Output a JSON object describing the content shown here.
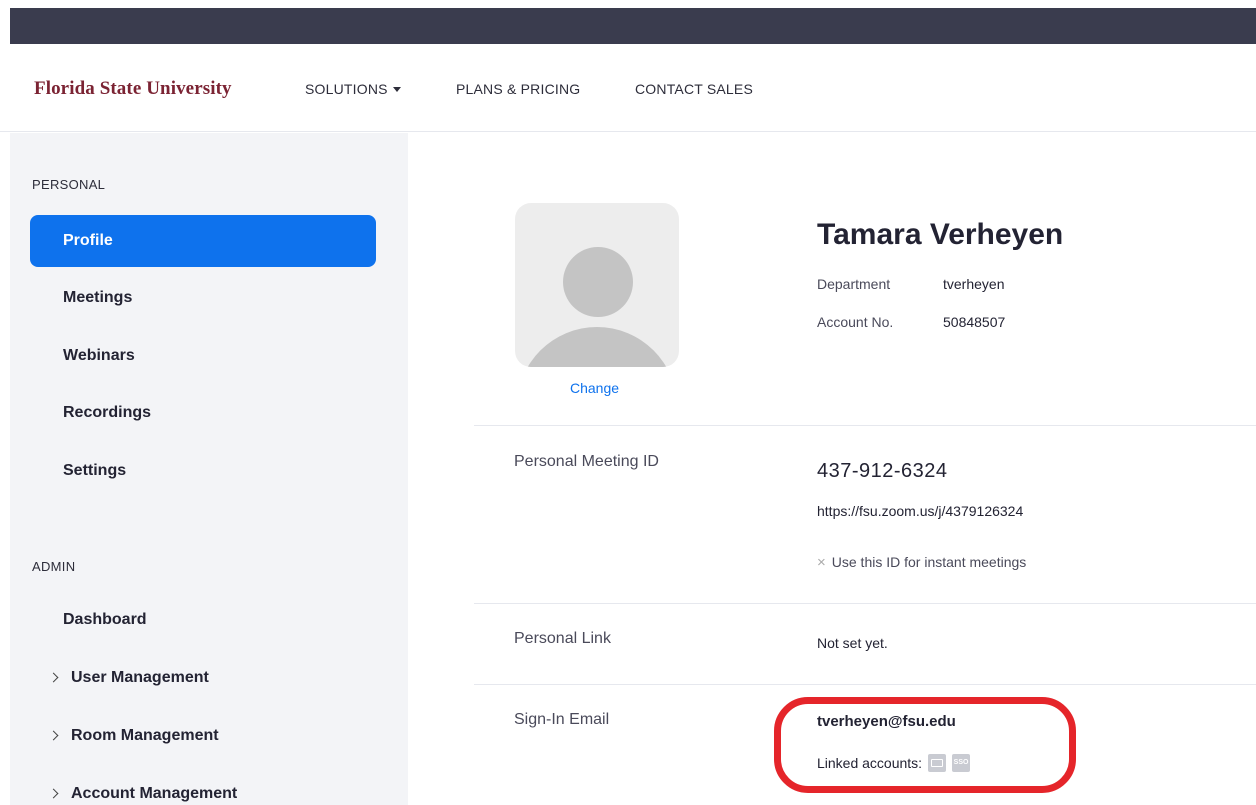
{
  "nav": {
    "brand": "Florida State University",
    "links": [
      "SOLUTIONS",
      "PLANS & PRICING",
      "CONTACT SALES"
    ]
  },
  "sidebar": {
    "personal_label": "PERSONAL",
    "personal_items": [
      "Profile",
      "Meetings",
      "Webinars",
      "Recordings",
      "Settings"
    ],
    "active_item": "Profile",
    "admin_label": "ADMIN",
    "admin_items": [
      "Dashboard",
      "User Management",
      "Room Management",
      "Account Management"
    ]
  },
  "profile": {
    "change_label": "Change",
    "name": "Tamara Verheyen",
    "department_label": "Department",
    "department_value": "tverheyen",
    "account_label": "Account No.",
    "account_value": "50848507"
  },
  "meeting": {
    "label": "Personal Meeting ID",
    "id": "437-912-6324",
    "url": "https://fsu.zoom.us/j/4379126324",
    "instant_text": "Use this ID for instant meetings"
  },
  "personal_link": {
    "label": "Personal Link",
    "value": "Not set yet."
  },
  "signin": {
    "label": "Sign-In Email",
    "email": "tverheyen@fsu.edu",
    "linked_label": "Linked accounts:",
    "linked_icons": [
      "mail-icon",
      "sso-icon"
    ],
    "sso_text": "SSO"
  },
  "colors": {
    "accent": "#0e72ed",
    "brand": "#7b2333",
    "highlight": "#e5252a",
    "topbar": "#3a3c4e"
  }
}
